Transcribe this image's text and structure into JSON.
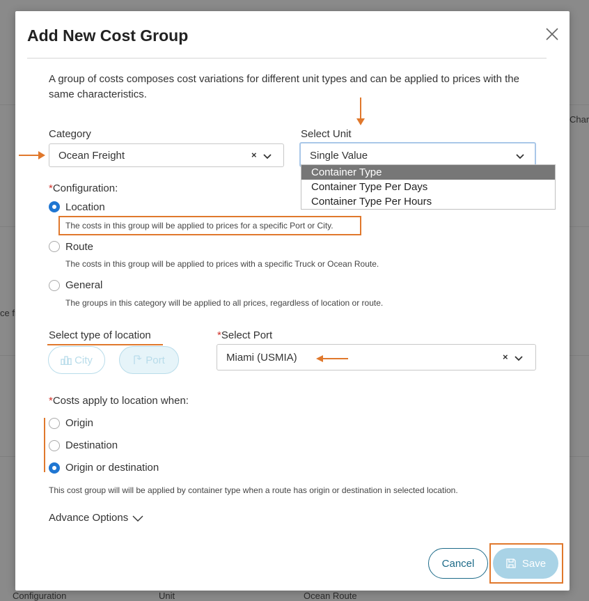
{
  "background": {
    "left_text": "ce fr",
    "right_text": "Char",
    "bottom_columns": [
      "Configuration",
      "Unit",
      "Ocean Route"
    ]
  },
  "modal": {
    "title": "Add New Cost Group",
    "description": "A group of costs composes cost variations for different unit types and can be applied to prices with the same characteristics.",
    "category": {
      "label": "Category",
      "value": "Ocean Freight"
    },
    "select_unit": {
      "label": "Select Unit",
      "value": "Single Value",
      "options": [
        "Container Type",
        "Container Type Per Days",
        "Container Type Per Hours"
      ],
      "highlighted": "Container Type"
    },
    "configuration": {
      "label": "Configuration:",
      "options": [
        {
          "label": "Location",
          "help": "The costs in this group will be applied to prices for a specific Port or City."
        },
        {
          "label": "Route",
          "help": "The costs in this group will be applied to prices with a specific Truck or Ocean Route."
        },
        {
          "label": "General",
          "help": "The groups in this category will be applied to all prices, regardless of location or route."
        }
      ],
      "selected": "Location"
    },
    "location_type": {
      "label": "Select type of location",
      "city": "City",
      "port": "Port"
    },
    "select_port": {
      "label": "Select Port",
      "value": "Miami (USMIA)"
    },
    "applies_when": {
      "label": "Costs apply to location when:",
      "options": [
        "Origin",
        "Destination",
        "Origin or destination"
      ],
      "selected": "Origin or destination"
    },
    "applies_help": "This cost group will will be applied by container type when a route has origin or destination in selected location.",
    "advance_label": "Advance Options",
    "cancel_label": "Cancel",
    "save_label": "Save"
  },
  "colors": {
    "accent": "#1f76d2",
    "annotation": "#e0782c",
    "save_disabled": "#a9d3e6"
  },
  "icons": {
    "close": "close-icon",
    "chevron": "chevron-down-icon",
    "city": "city-icon",
    "port": "port-icon",
    "save": "save-icon"
  }
}
